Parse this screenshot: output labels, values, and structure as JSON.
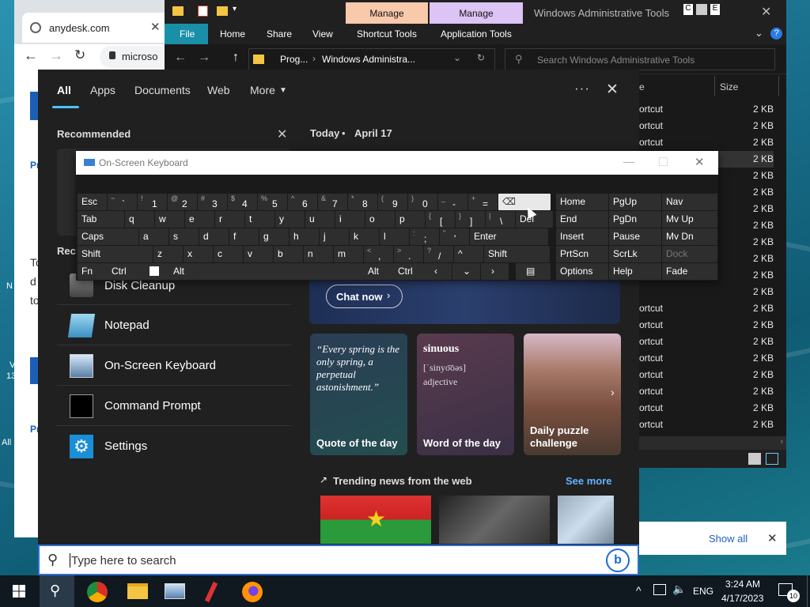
{
  "browser": {
    "tab_title": "anydesk.com",
    "address": "microso",
    "side_labels": [
      "Pr",
      "To",
      "d",
      "to",
      "N",
      "V",
      "13",
      "Pr",
      "All"
    ]
  },
  "explorer": {
    "manage1": "Manage",
    "manage2": "Manage",
    "title": "Windows Administrative Tools",
    "ribbon": [
      "File",
      "Home",
      "Share",
      "View",
      "Shortcut Tools",
      "Application Tools"
    ],
    "breadcrumb_prog": "Prog...",
    "breadcrumb_current": "Windows Administra...",
    "search_placeholder": "Search Windows Administrative Tools",
    "col_name": "e",
    "col_size": "Size",
    "rows": [
      {
        "name": "ortcut",
        "size": "2 KB"
      },
      {
        "name": "ortcut",
        "size": "2 KB"
      },
      {
        "name": "ortcut",
        "size": "2 KB"
      },
      {
        "name": "",
        "size": "2 KB"
      },
      {
        "name": "",
        "size": "2 KB"
      },
      {
        "name": "",
        "size": "2 KB"
      },
      {
        "name": "",
        "size": "2 KB"
      },
      {
        "name": "",
        "size": "2 KB"
      },
      {
        "name": "",
        "size": "2 KB"
      },
      {
        "name": "",
        "size": "2 KB"
      },
      {
        "name": "",
        "size": "2 KB"
      },
      {
        "name": "",
        "size": "2 KB"
      },
      {
        "name": "ortcut",
        "size": "2 KB"
      },
      {
        "name": "ortcut",
        "size": "2 KB"
      },
      {
        "name": "ortcut",
        "size": "2 KB"
      },
      {
        "name": "ortcut",
        "size": "2 KB"
      },
      {
        "name": "ortcut",
        "size": "2 KB"
      },
      {
        "name": "ortcut",
        "size": "2 KB"
      },
      {
        "name": "ortcut",
        "size": "2 KB"
      },
      {
        "name": "ortcut",
        "size": "2 KB"
      },
      {
        "name": "ortcut",
        "size": "2 KB"
      }
    ]
  },
  "start": {
    "tabs": [
      "All",
      "Apps",
      "Documents",
      "Web",
      "More"
    ],
    "recommended": "Recommended",
    "recent_partial": "Rec",
    "today": "Today",
    "date": "April 17",
    "recent": [
      "Disk Cleanup",
      "Notepad",
      "On-Screen Keyboard",
      "Command Prompt",
      "Settings"
    ],
    "chat_now": "Chat now",
    "quote_text": "“Every spring is the only spring, a perpetual astonishment.”",
    "quote_label": "Quote of the day",
    "word": "sinuous",
    "word_pron": "[ˈsinyo͞oəs]",
    "word_pos": "adjective",
    "word_label": "Word of the day",
    "puzzle_label": "Daily puzzle challenge",
    "trending": "Trending news from the web",
    "see_more": "See more"
  },
  "osk": {
    "title": "On-Screen Keyboard",
    "row1": [
      [
        "",
        "Esc"
      ],
      [
        "~",
        "`"
      ],
      [
        "!",
        "1"
      ],
      [
        "@",
        "2"
      ],
      [
        "#",
        "3"
      ],
      [
        "$",
        "4"
      ],
      [
        "%",
        "5"
      ],
      [
        "^",
        "6"
      ],
      [
        "&",
        "7"
      ],
      [
        "*",
        "8"
      ],
      [
        "(",
        "9"
      ],
      [
        ")",
        "0"
      ],
      [
        "_",
        "-"
      ],
      [
        "+",
        "="
      ]
    ],
    "row2": [
      [
        "",
        "Tab"
      ],
      [
        "",
        "q"
      ],
      [
        "",
        "w"
      ],
      [
        "",
        "e"
      ],
      [
        "",
        "r"
      ],
      [
        "",
        "t"
      ],
      [
        "",
        "y"
      ],
      [
        "",
        "u"
      ],
      [
        "",
        "i"
      ],
      [
        "",
        "o"
      ],
      [
        "",
        "p"
      ],
      [
        "{",
        "["
      ],
      [
        "}",
        "]"
      ],
      [
        "|",
        "\\"
      ],
      [
        "",
        "Del"
      ]
    ],
    "row3": [
      [
        "",
        "Caps"
      ],
      [
        "",
        "a"
      ],
      [
        "",
        "s"
      ],
      [
        "",
        "d"
      ],
      [
        "",
        "f"
      ],
      [
        "",
        "g"
      ],
      [
        "",
        "h"
      ],
      [
        "",
        "j"
      ],
      [
        "",
        "k"
      ],
      [
        "",
        "l"
      ],
      [
        ":",
        ";"
      ],
      [
        "\"",
        "'"
      ],
      [
        "",
        "Enter"
      ]
    ],
    "row4": [
      [
        "",
        "Shift"
      ],
      [
        "",
        "z"
      ],
      [
        "",
        "x"
      ],
      [
        "",
        "c"
      ],
      [
        "",
        "v"
      ],
      [
        "",
        "b"
      ],
      [
        "",
        "n"
      ],
      [
        "",
        "m"
      ],
      [
        "<",
        ","
      ],
      [
        ">",
        "."
      ],
      [
        "?",
        "/"
      ],
      [
        "",
        "^"
      ],
      [
        "",
        "Shift"
      ]
    ],
    "row5": [
      "Fn",
      "Ctrl",
      "Alt",
      "Alt",
      "Ctrl",
      "Options",
      "Help",
      "Fade"
    ],
    "nav": [
      [
        "Home",
        "PgUp",
        "Nav"
      ],
      [
        "End",
        "PgDn",
        "Mv Up"
      ],
      [
        "Insert",
        "Pause",
        "Mv Dn"
      ],
      [
        "PrtScn",
        "ScrLk",
        "Dock"
      ]
    ]
  },
  "search": {
    "placeholder": "Type here to search"
  },
  "notification": {
    "show_all": "Show all"
  },
  "taskbar": {
    "lang": "ENG",
    "time": "3:24 AM",
    "date": "4/17/2023",
    "badge": "10"
  },
  "colors": {
    "accent": "#2f6fd6",
    "manage1": "#f9c9ac",
    "manage2": "#dcc4f4",
    "link": "#63b3ff"
  }
}
